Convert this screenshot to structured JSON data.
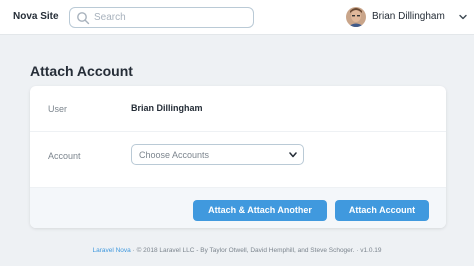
{
  "header": {
    "brand": "Nova Site",
    "search": {
      "placeholder": "Search",
      "value": ""
    },
    "user": {
      "name": "Brian Dillingham"
    }
  },
  "page": {
    "title": "Attach Account"
  },
  "form": {
    "user_label": "User",
    "user_value": "Brian Dillingham",
    "account_label": "Account",
    "account_select": {
      "selected": "Choose Accounts"
    }
  },
  "actions": {
    "attach_another_label": "Attach & Attach Another",
    "attach_label": "Attach Account"
  },
  "footer": {
    "link_label": "Laravel Nova",
    "copyright": "· © 2018 Laravel LLC - By Taylor Otwell, David Hemphill, and Steve Schoger.",
    "version": "· v1.0.19"
  },
  "colors": {
    "accent": "#4099de",
    "background": "#eef1f4",
    "card": "#ffffff",
    "footer_bar": "#f4f7fa"
  }
}
